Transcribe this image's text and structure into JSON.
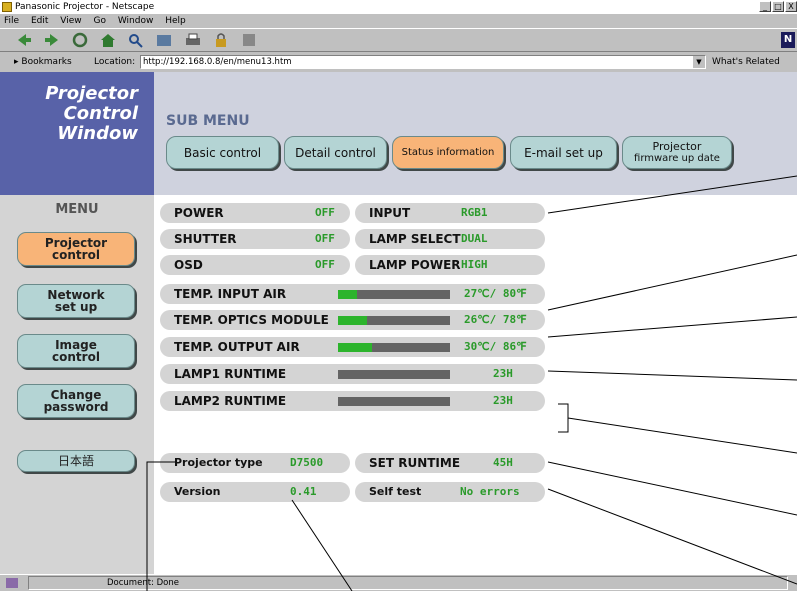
{
  "window": {
    "title": "Panasonic Projector - Netscape",
    "controls": [
      "_",
      "□",
      "X"
    ]
  },
  "menubar": {
    "items": [
      "File",
      "Edit",
      "View",
      "Go",
      "Window",
      "Help"
    ]
  },
  "toolbar": {
    "icons": [
      "back-icon",
      "forward-icon",
      "reload-icon",
      "home-icon",
      "search-icon",
      "my-netscape-icon",
      "print-icon",
      "security-icon",
      "stop-icon"
    ],
    "logo": "N"
  },
  "location": {
    "bookmarks": "Bookmarks",
    "label": "Location:",
    "url": "http://192.168.0.8/en/menu13.htm",
    "related": "What's Related"
  },
  "status": {
    "text": "Document: Done"
  },
  "page": {
    "logo": "Projector Control Window",
    "submenu_title": "SUB MENU",
    "tabs": [
      {
        "label": "Basic control",
        "active": false
      },
      {
        "label": "Detail control",
        "active": false
      },
      {
        "label": "Status information",
        "active": true
      },
      {
        "label": "E-mail set up",
        "active": false
      },
      {
        "label_line1": "Projector",
        "label_line2": "firmware up date",
        "active": false
      }
    ],
    "menu_title": "MENU",
    "menu": [
      {
        "line1": "Projector",
        "line2": "control",
        "active": true
      },
      {
        "line1": "Network",
        "line2": "set up",
        "active": false
      },
      {
        "line1": "Image",
        "line2": "control",
        "active": false
      },
      {
        "line1": "Change",
        "line2": "password",
        "active": false
      },
      {
        "line1": "日本語",
        "line2": "",
        "active": false
      }
    ],
    "status_left": [
      {
        "label": "POWER",
        "value": "OFF"
      },
      {
        "label": "SHUTTER",
        "value": "OFF"
      },
      {
        "label": "OSD",
        "value": "OFF"
      }
    ],
    "status_right": [
      {
        "label": "INPUT",
        "value": "RGB1"
      },
      {
        "label": "LAMP SELECT",
        "value": "DUAL"
      },
      {
        "label": "LAMP POWER",
        "value": "HIGH"
      }
    ],
    "bars": [
      {
        "label": "TEMP. INPUT AIR",
        "value": "27℃/ 80℉",
        "level": 0.17
      },
      {
        "label": "TEMP. OPTICS MODULE",
        "value": "26℃/ 78℉",
        "level": 0.26
      },
      {
        "label": "TEMP. OUTPUT AIR",
        "value": "30℃/ 86℉",
        "level": 0.3
      },
      {
        "label": "LAMP1 RUNTIME",
        "value": "23H",
        "level": 0.0
      },
      {
        "label": "LAMP2 RUNTIME",
        "value": "23H",
        "level": 0.0
      }
    ],
    "projector_type": {
      "label": "Projector type",
      "value": "D7500"
    },
    "set_runtime": {
      "label": "SET RUNTIME",
      "value": "45H"
    },
    "version": {
      "label": "Version",
      "value": "0.41"
    },
    "self_test": {
      "label": "Self test",
      "value": "No errors"
    }
  },
  "colors": {
    "accent": "#f8b478",
    "button": "#b4d4d4",
    "logo_panel": "#5862a8",
    "value_green": "#2a9a2a",
    "bar_fill": "#2cb42c"
  }
}
